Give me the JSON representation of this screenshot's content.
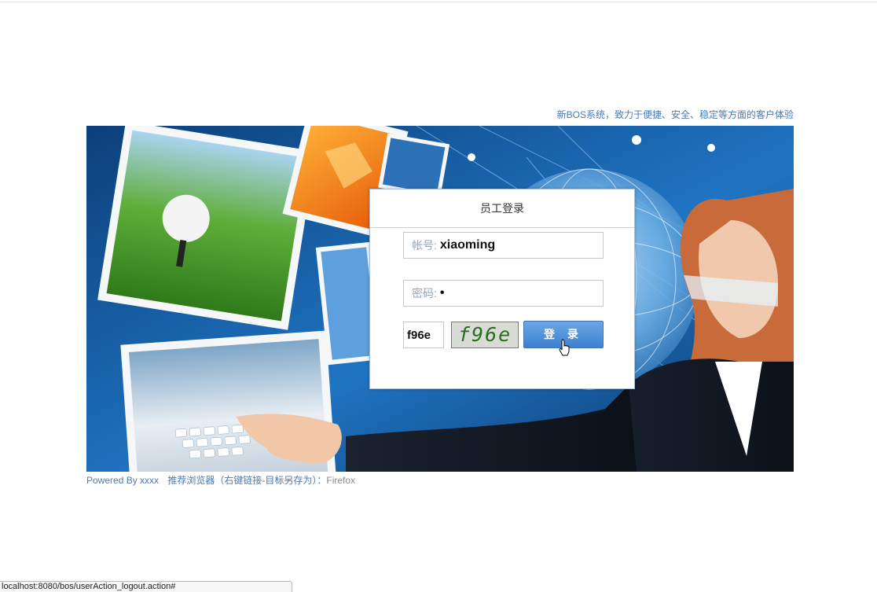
{
  "header": {
    "slogan": "新BOS系统，致力于便捷、安全、稳定等方面的客户体验"
  },
  "login": {
    "title": "员工登录",
    "username_label": "帐号:",
    "username_value": "xiaoming",
    "password_label": "密码:",
    "password_value": "•",
    "captcha_input_value": "f96e",
    "captcha_image_text": "f96e",
    "login_button_label": "登 录"
  },
  "footer": {
    "powered_by": "Powered By xxxx",
    "browser_hint": "推荐浏览器（右键链接-目标另存为）：",
    "browser_name": "Firefox"
  },
  "statusbar": {
    "url": "localhost:8080/bos/userAction_logout.action#"
  },
  "colors": {
    "link_blue": "#4a7ab5",
    "button_blue": "#3d80cf",
    "captcha_green": "#2b6b1f"
  }
}
